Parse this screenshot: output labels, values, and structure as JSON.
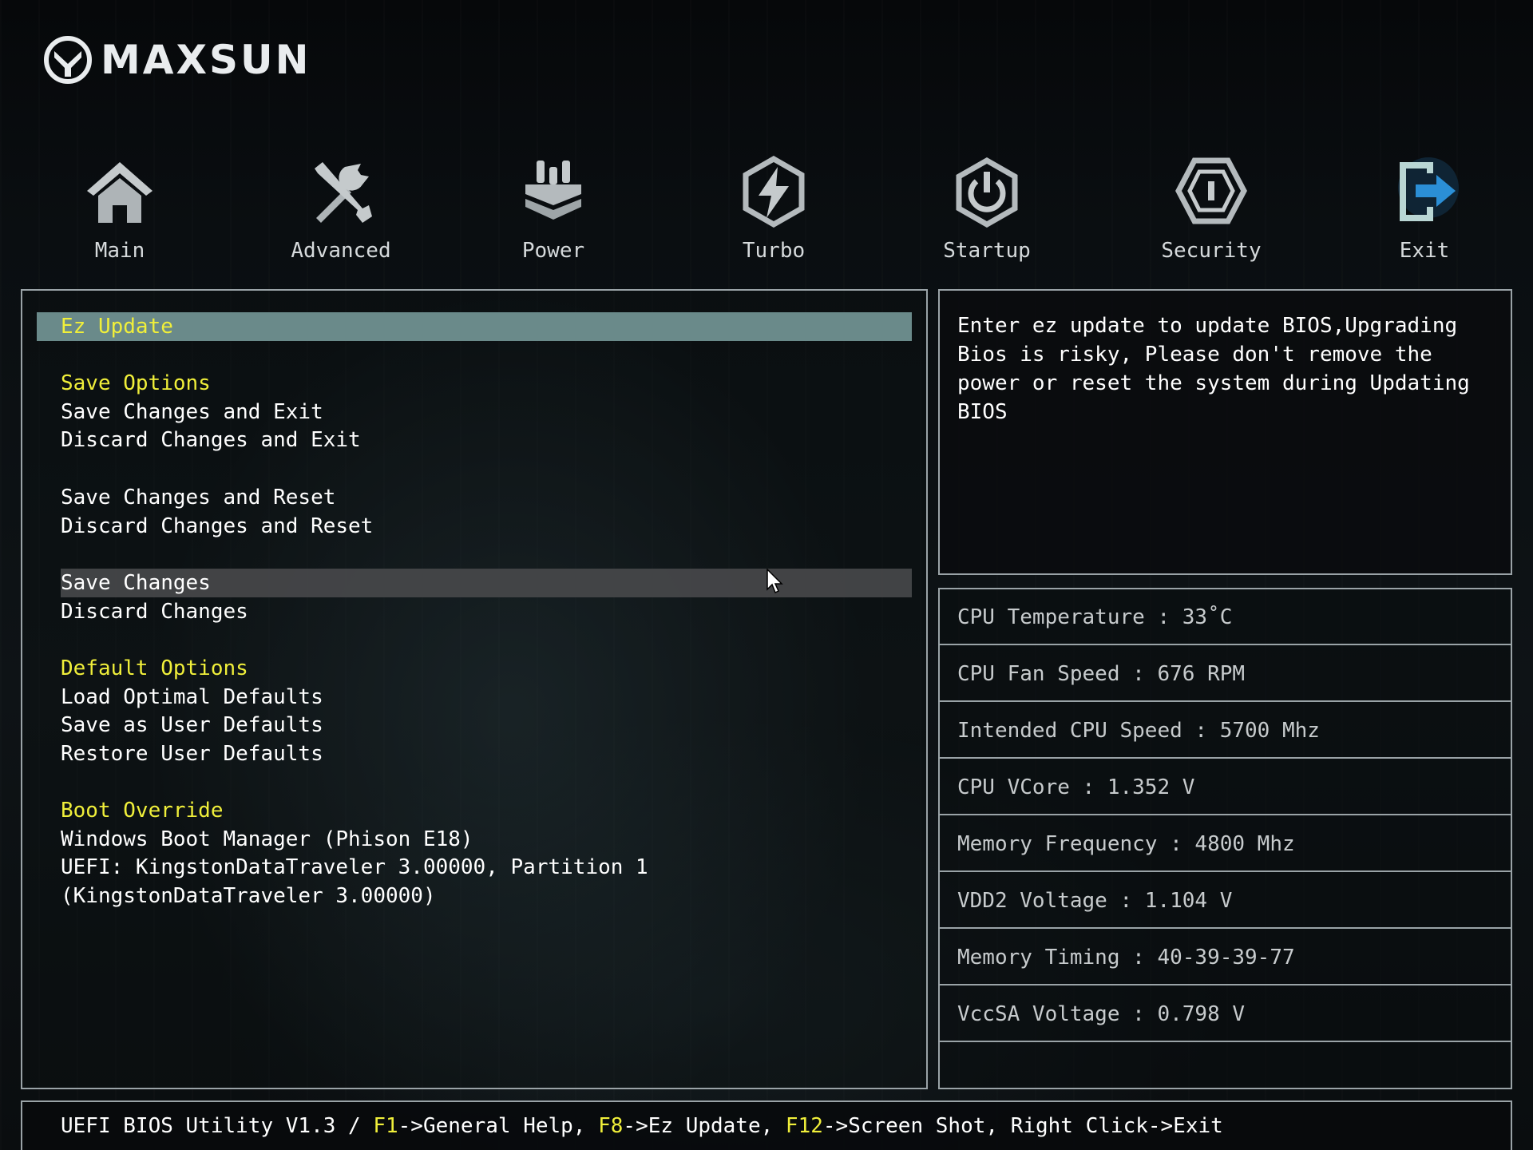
{
  "brand": {
    "name": "MAXSUN"
  },
  "nav": [
    {
      "label": "Main",
      "icon": "home-icon"
    },
    {
      "label": "Advanced",
      "icon": "tools-icon"
    },
    {
      "label": "Power",
      "icon": "power-plug-icon"
    },
    {
      "label": "Turbo",
      "icon": "lightning-icon"
    },
    {
      "label": "Startup",
      "icon": "power-button-icon"
    },
    {
      "label": "Security",
      "icon": "shield-icon"
    },
    {
      "label": "Exit",
      "icon": "exit-door-icon",
      "active": true
    }
  ],
  "menu": {
    "ez_update": "Ez Update",
    "save_options_heading": "Save Options",
    "save_changes_exit": "Save Changes and Exit",
    "discard_changes_exit": "Discard Changes and Exit",
    "save_changes_reset": "Save Changes and Reset",
    "discard_changes_reset": "Discard Changes and Reset",
    "save_changes": "Save Changes",
    "discard_changes": "Discard Changes",
    "default_options_heading": "Default Options",
    "load_optimal_defaults": "Load Optimal Defaults",
    "save_user_defaults": "Save as User Defaults",
    "restore_user_defaults": "Restore User Defaults",
    "boot_override_heading": "Boot Override",
    "boot_windows": "Windows Boot Manager (Phison E18)",
    "boot_uefi_line1": "UEFI: KingstonDataTraveler 3.00000, Partition 1",
    "boot_uefi_line2": "(KingstonDataTraveler 3.00000)"
  },
  "help": {
    "text": "Enter ez update to update BIOS,Upgrading\nBios is risky, Please don't remove the\npower or reset the system during Updating\nBIOS"
  },
  "status": [
    "CPU Temperature : 33˚C",
    "CPU Fan Speed : 676 RPM",
    "Intended CPU Speed : 5700 Mhz",
    "CPU VCore : 1.352 V",
    "Memory Frequency : 4800 Mhz",
    "VDD2 Voltage : 1.104 V",
    "Memory Timing : 40-39-39-77",
    "VccSA Voltage : 0.798 V"
  ],
  "footer": {
    "prefix": "UEFI BIOS Utility V1.3 / ",
    "f1_key": "F1",
    "f1_text": "->General Help, ",
    "f8_key": "F8",
    "f8_text": "->Ez Update, ",
    "f12_key": "F12",
    "f12_text": "->Screen Shot, Right Click->Exit"
  },
  "colors": {
    "highlight_text": "#f0ef3a",
    "selected_bar": "#6a8a8a",
    "panel_border": "#9aa3a7",
    "exit_icon_accent": "#2b8fd6"
  }
}
